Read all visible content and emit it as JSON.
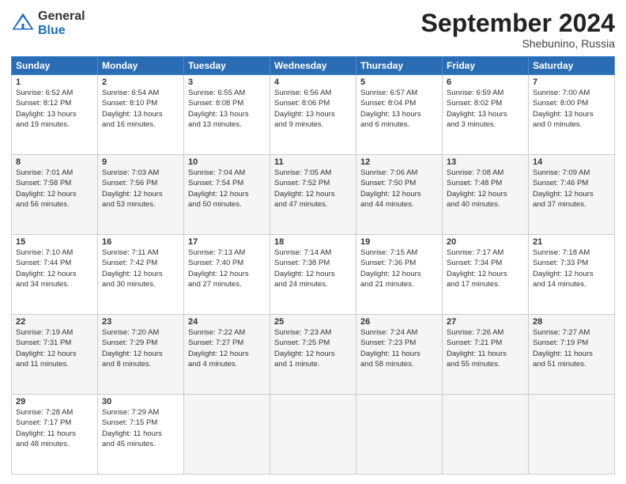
{
  "header": {
    "logo_general": "General",
    "logo_blue": "Blue",
    "month_title": "September 2024",
    "location": "Shebunino, Russia"
  },
  "days_of_week": [
    "Sunday",
    "Monday",
    "Tuesday",
    "Wednesday",
    "Thursday",
    "Friday",
    "Saturday"
  ],
  "weeks": [
    [
      {
        "day": "1",
        "info": "Sunrise: 6:52 AM\nSunset: 8:12 PM\nDaylight: 13 hours\nand 19 minutes."
      },
      {
        "day": "2",
        "info": "Sunrise: 6:54 AM\nSunset: 8:10 PM\nDaylight: 13 hours\nand 16 minutes."
      },
      {
        "day": "3",
        "info": "Sunrise: 6:55 AM\nSunset: 8:08 PM\nDaylight: 13 hours\nand 13 minutes."
      },
      {
        "day": "4",
        "info": "Sunrise: 6:56 AM\nSunset: 8:06 PM\nDaylight: 13 hours\nand 9 minutes."
      },
      {
        "day": "5",
        "info": "Sunrise: 6:57 AM\nSunset: 8:04 PM\nDaylight: 13 hours\nand 6 minutes."
      },
      {
        "day": "6",
        "info": "Sunrise: 6:59 AM\nSunset: 8:02 PM\nDaylight: 13 hours\nand 3 minutes."
      },
      {
        "day": "7",
        "info": "Sunrise: 7:00 AM\nSunset: 8:00 PM\nDaylight: 13 hours\nand 0 minutes."
      }
    ],
    [
      {
        "day": "8",
        "info": "Sunrise: 7:01 AM\nSunset: 7:58 PM\nDaylight: 12 hours\nand 56 minutes."
      },
      {
        "day": "9",
        "info": "Sunrise: 7:03 AM\nSunset: 7:56 PM\nDaylight: 12 hours\nand 53 minutes."
      },
      {
        "day": "10",
        "info": "Sunrise: 7:04 AM\nSunset: 7:54 PM\nDaylight: 12 hours\nand 50 minutes."
      },
      {
        "day": "11",
        "info": "Sunrise: 7:05 AM\nSunset: 7:52 PM\nDaylight: 12 hours\nand 47 minutes."
      },
      {
        "day": "12",
        "info": "Sunrise: 7:06 AM\nSunset: 7:50 PM\nDaylight: 12 hours\nand 44 minutes."
      },
      {
        "day": "13",
        "info": "Sunrise: 7:08 AM\nSunset: 7:48 PM\nDaylight: 12 hours\nand 40 minutes."
      },
      {
        "day": "14",
        "info": "Sunrise: 7:09 AM\nSunset: 7:46 PM\nDaylight: 12 hours\nand 37 minutes."
      }
    ],
    [
      {
        "day": "15",
        "info": "Sunrise: 7:10 AM\nSunset: 7:44 PM\nDaylight: 12 hours\nand 34 minutes."
      },
      {
        "day": "16",
        "info": "Sunrise: 7:11 AM\nSunset: 7:42 PM\nDaylight: 12 hours\nand 30 minutes."
      },
      {
        "day": "17",
        "info": "Sunrise: 7:13 AM\nSunset: 7:40 PM\nDaylight: 12 hours\nand 27 minutes."
      },
      {
        "day": "18",
        "info": "Sunrise: 7:14 AM\nSunset: 7:38 PM\nDaylight: 12 hours\nand 24 minutes."
      },
      {
        "day": "19",
        "info": "Sunrise: 7:15 AM\nSunset: 7:36 PM\nDaylight: 12 hours\nand 21 minutes."
      },
      {
        "day": "20",
        "info": "Sunrise: 7:17 AM\nSunset: 7:34 PM\nDaylight: 12 hours\nand 17 minutes."
      },
      {
        "day": "21",
        "info": "Sunrise: 7:18 AM\nSunset: 7:33 PM\nDaylight: 12 hours\nand 14 minutes."
      }
    ],
    [
      {
        "day": "22",
        "info": "Sunrise: 7:19 AM\nSunset: 7:31 PM\nDaylight: 12 hours\nand 11 minutes."
      },
      {
        "day": "23",
        "info": "Sunrise: 7:20 AM\nSunset: 7:29 PM\nDaylight: 12 hours\nand 8 minutes."
      },
      {
        "day": "24",
        "info": "Sunrise: 7:22 AM\nSunset: 7:27 PM\nDaylight: 12 hours\nand 4 minutes."
      },
      {
        "day": "25",
        "info": "Sunrise: 7:23 AM\nSunset: 7:25 PM\nDaylight: 12 hours\nand 1 minute."
      },
      {
        "day": "26",
        "info": "Sunrise: 7:24 AM\nSunset: 7:23 PM\nDaylight: 11 hours\nand 58 minutes."
      },
      {
        "day": "27",
        "info": "Sunrise: 7:26 AM\nSunset: 7:21 PM\nDaylight: 11 hours\nand 55 minutes."
      },
      {
        "day": "28",
        "info": "Sunrise: 7:27 AM\nSunset: 7:19 PM\nDaylight: 11 hours\nand 51 minutes."
      }
    ],
    [
      {
        "day": "29",
        "info": "Sunrise: 7:28 AM\nSunset: 7:17 PM\nDaylight: 11 hours\nand 48 minutes."
      },
      {
        "day": "30",
        "info": "Sunrise: 7:29 AM\nSunset: 7:15 PM\nDaylight: 11 hours\nand 45 minutes."
      },
      null,
      null,
      null,
      null,
      null
    ]
  ]
}
